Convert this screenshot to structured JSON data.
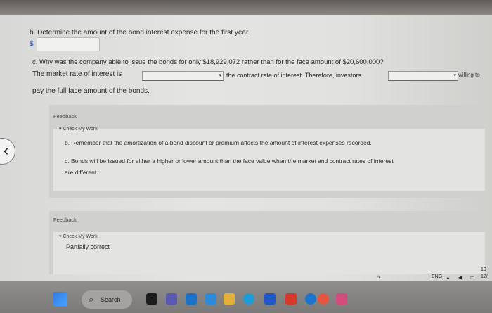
{
  "question_b": {
    "title": "b. Determine the amount of the bond interest expense for the first year.",
    "currency_symbol": "$",
    "answer_value": ""
  },
  "question_c": {
    "title": "c. Why was the company able to issue the bonds for only $18,929,072 rather than for the face amount of $20,600,000?",
    "line2_start": "The market rate of interest is",
    "dropdown1_value": "",
    "line2_middle": "the contract rate of interest. Therefore, investors",
    "dropdown2_value": "",
    "line2_end": "willing to",
    "line3": "pay the full face amount of the bonds."
  },
  "feedback1": {
    "label": "Feedback",
    "check_label": "Check My Work",
    "line_b": "b. Remember that the amortization of a bond discount or premium affects the amount of interest expenses recorded.",
    "line_c1": "c. Bonds will be issued for either a higher or lower amount than the face value when the market and contract rates of interest",
    "line_c2": "are different."
  },
  "feedback2": {
    "label": "Feedback",
    "check_label": "Check My Work",
    "status": "Partially correct"
  },
  "taskbar": {
    "search_label": "Search",
    "language": "ENG",
    "clock_time": "10",
    "clock_date": "12/"
  },
  "colors": {
    "screen_bg": "#e2e2e0",
    "feedback_bg": "#d0d0ce",
    "link_blue": "#1f3f9a",
    "taskbar_bg": "#858482"
  }
}
